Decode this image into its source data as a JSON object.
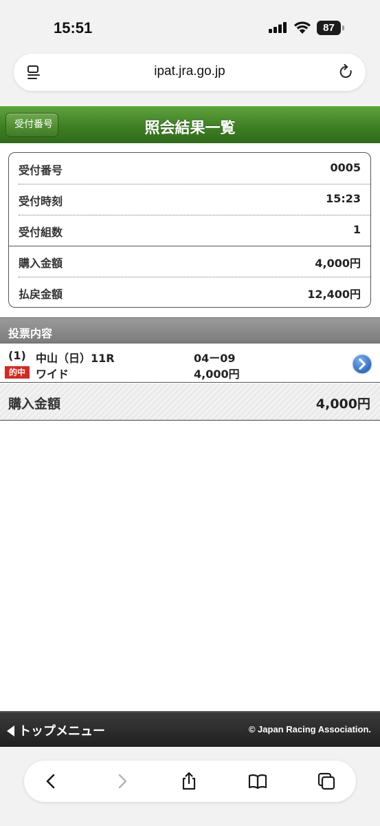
{
  "status_bar": {
    "time": "15:51",
    "battery": "87"
  },
  "browser": {
    "url": "ipat.jra.go.jp"
  },
  "header": {
    "back_label": "受付番号",
    "title": "照会結果一覧"
  },
  "summary": [
    {
      "label": "受付番号",
      "value": "0005"
    },
    {
      "label": "受付時刻",
      "value": "15:23"
    },
    {
      "label": "受付組数",
      "value": "1"
    },
    {
      "label": "購入金額",
      "value": "4,000円"
    },
    {
      "label": "払戻金額",
      "value": "12,400円"
    }
  ],
  "bets": {
    "section_title": "投票内容",
    "items": [
      {
        "number": "(1)",
        "venue": "中山（日）11R",
        "combination": "04ー09",
        "result_badge": "的中",
        "bet_type": "ワイド",
        "amount": "4,000円"
      }
    ],
    "total_label": "購入金額",
    "total_value": "4,000円"
  },
  "footer": {
    "top_menu_label": "トップメニュー",
    "copyright": "© Japan Racing Association."
  },
  "colors": {
    "header_green": "#3e7f24",
    "hit_red": "#d7281d",
    "link_blue": "#2f6fd0"
  }
}
